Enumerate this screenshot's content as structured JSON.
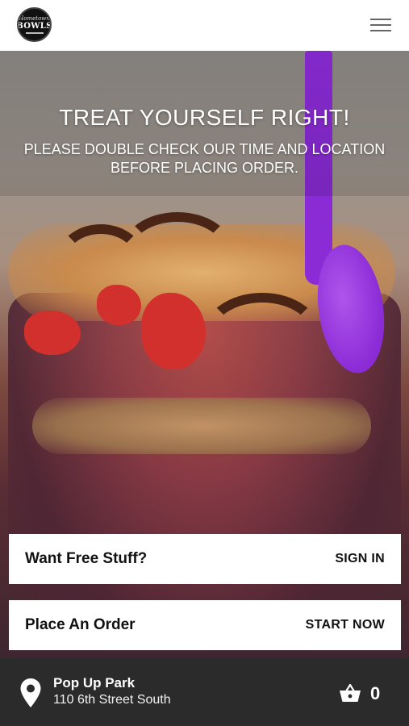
{
  "header": {
    "logo_text_top": "Hometown",
    "logo_text_main": "BOWLS",
    "menu_icon": "hamburger-menu-icon"
  },
  "hero": {
    "headline": "TREAT YOURSELF RIGHT!",
    "subline": "PLEASE DOUBLE CHECK OUR TIME AND LOCATION BEFORE PLACING ORDER."
  },
  "cards": {
    "rewards": {
      "title": "Want Free Stuff?",
      "action": "SIGN IN"
    },
    "order": {
      "title": "Place An Order",
      "action": "START NOW"
    }
  },
  "footer": {
    "location_name": "Pop Up Park",
    "location_address": "110 6th Street South",
    "cart_count": "0",
    "pin_icon": "location-pin-icon",
    "cart_icon": "shopping-basket-icon"
  },
  "colors": {
    "footer_bg": "#2b2b2b",
    "accent_spoon": "#8a2bd6"
  }
}
